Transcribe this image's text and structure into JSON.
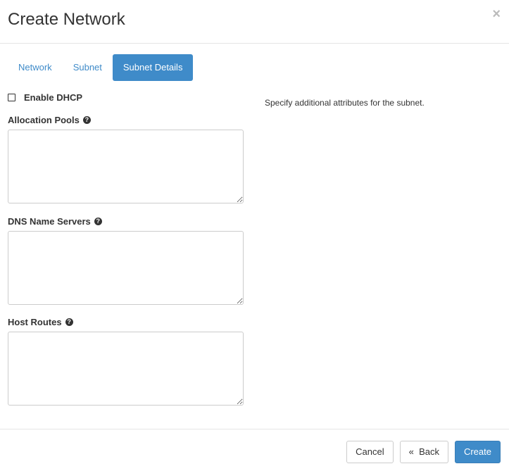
{
  "dialog": {
    "title": "Create Network",
    "close_icon": "×"
  },
  "tabs": [
    {
      "label": "Network",
      "active": false
    },
    {
      "label": "Subnet",
      "active": false
    },
    {
      "label": "Subnet Details",
      "active": true
    }
  ],
  "form": {
    "enable_dhcp": {
      "label": "Enable DHCP",
      "checked": false
    },
    "allocation_pools": {
      "label": "Allocation Pools",
      "value": "",
      "help_icon": "?"
    },
    "dns_name_servers": {
      "label": "DNS Name Servers",
      "value": "",
      "help_icon": "?"
    },
    "host_routes": {
      "label": "Host Routes",
      "value": "",
      "help_icon": "?"
    }
  },
  "description": "Specify additional attributes for the subnet.",
  "footer": {
    "cancel_label": "Cancel",
    "back_label": "«  Back",
    "create_label": "Create"
  },
  "colors": {
    "accent": "#3f8bc9"
  }
}
